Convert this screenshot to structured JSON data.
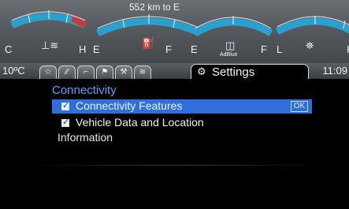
{
  "gauges": {
    "range_text": "552 km to E",
    "letters": [
      "C",
      "H",
      "E",
      "F",
      "E",
      "F",
      "L",
      "H"
    ],
    "adblue_label": "AdBlue",
    "icons": [
      "coolant-temp-icon",
      "fuel-pump-icon",
      "adblue-icon",
      "oil-can-icon"
    ]
  },
  "status": {
    "temperature": "10ºC",
    "time": "11:09",
    "tabs": [
      "star-icon",
      "trip-icon",
      "seat-icon",
      "vehicle-icon",
      "wrench-icon",
      "road-icon"
    ],
    "active_tab": {
      "label": "Settings",
      "icon": "gears-icon"
    }
  },
  "menu": {
    "section_title": "Connectivity",
    "items": [
      {
        "label": "Connectivity Features",
        "checked": true,
        "selected": true,
        "ok_label": "OK"
      },
      {
        "label": "Vehicle Data and Location",
        "checked": true,
        "selected": false
      }
    ],
    "info_label": "Information"
  },
  "colors": {
    "accent": "#2e6fd9",
    "section_title": "#5aa0ff",
    "background": "#000000"
  }
}
